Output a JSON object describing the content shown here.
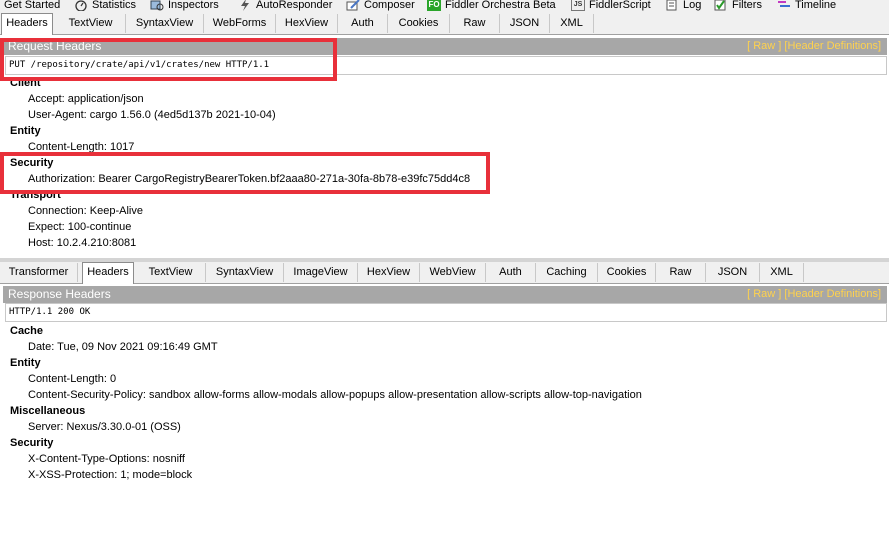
{
  "main_tabs": [
    {
      "label": "Get Started",
      "icon": "none"
    },
    {
      "label": "Statistics",
      "icon": "stopwatch-icon"
    },
    {
      "label": "Inspectors",
      "icon": "inspector-icon"
    },
    {
      "label": "AutoResponder",
      "icon": "lightning-icon"
    },
    {
      "label": "Composer",
      "icon": "pencil-icon"
    },
    {
      "label": "Fiddler Orchestra Beta",
      "icon": "fo-icon",
      "badge": "FO"
    },
    {
      "label": "FiddlerScript",
      "icon": "script-icon",
      "badge": "JS"
    },
    {
      "label": "Log",
      "icon": "log-icon"
    },
    {
      "label": "Filters",
      "icon": "checkbox-icon"
    },
    {
      "label": "Timeline",
      "icon": "timeline-icon"
    }
  ],
  "request": {
    "tabs": [
      "Headers",
      "TextView",
      "SyntaxView",
      "WebForms",
      "HexView",
      "Auth",
      "Cookies",
      "Raw",
      "JSON",
      "XML"
    ],
    "active_tab": "Headers",
    "section_title": "Request Headers",
    "links": "[ Raw ]   [Header Definitions]",
    "request_line": "PUT /repository/crate/api/v1/crates/new HTTP/1.1",
    "groups": [
      {
        "name": "Client",
        "items": [
          "Accept: application/json",
          "User-Agent: cargo 1.56.0 (4ed5d137b 2021-10-04)"
        ]
      },
      {
        "name": "Entity",
        "items": [
          "Content-Length: 1017"
        ]
      },
      {
        "name": "Security",
        "items": [
          "Authorization: Bearer CargoRegistryBearerToken.bf2aaa80-271a-30fa-8b78-e39fc75dd4c8"
        ]
      },
      {
        "name": "Transport",
        "items": [
          "Connection: Keep-Alive",
          "Expect: 100-continue",
          "Host: 10.2.4.210:8081"
        ]
      }
    ]
  },
  "response": {
    "tabs": [
      "Transformer",
      "Headers",
      "TextView",
      "SyntaxView",
      "ImageView",
      "HexView",
      "WebView",
      "Auth",
      "Caching",
      "Cookies",
      "Raw",
      "JSON",
      "XML"
    ],
    "active_tab": "Headers",
    "section_title": "Response Headers",
    "links": "[ Raw ]   [Header Definitions]",
    "status_line": "HTTP/1.1 200 OK",
    "groups": [
      {
        "name": "Cache",
        "items": [
          "Date: Tue, 09 Nov 2021 09:16:49 GMT"
        ]
      },
      {
        "name": "Entity",
        "items": [
          "Content-Length: 0",
          "Content-Security-Policy: sandbox allow-forms allow-modals allow-popups allow-presentation allow-scripts allow-top-navigation"
        ]
      },
      {
        "name": "Miscellaneous",
        "items": [
          "Server: Nexus/3.30.0-01 (OSS)"
        ]
      },
      {
        "name": "Security",
        "items": [
          "X-Content-Type-Options: nosniff",
          "X-XSS-Protection: 1; mode=block"
        ]
      }
    ]
  },
  "colors": {
    "highlight": "#e8303a",
    "header_bar": "#a7a7a7",
    "link": "#ffd24d"
  }
}
